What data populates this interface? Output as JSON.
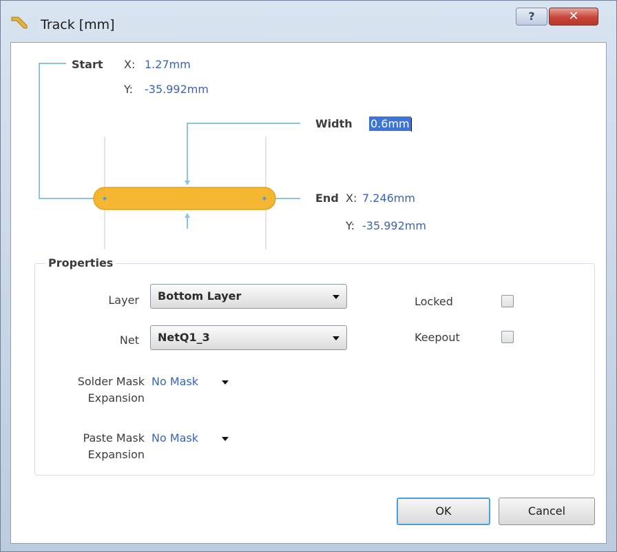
{
  "window": {
    "title": "Track [mm]",
    "help_label": "?",
    "close_label": "✕"
  },
  "diagram": {
    "start_label": "Start",
    "start_x_label": "X:",
    "start_x_value": "1.27mm",
    "start_y_label": "Y:",
    "start_y_value": "-35.992mm",
    "width_label": "Width",
    "width_value": "0.6mm",
    "end_label": "End",
    "end_x_label": "X:",
    "end_x_value": "7.246mm",
    "end_y_label": "Y:",
    "end_y_value": "-35.992mm"
  },
  "properties": {
    "group_title": "Properties",
    "layer_label": "Layer",
    "layer_value": "Bottom Layer",
    "net_label": "Net",
    "net_value": "NetQ1_3",
    "locked_label": "Locked",
    "keepout_label": "Keepout",
    "solder_mask_label_1": "Solder Mask",
    "solder_mask_label_2": "Expansion",
    "solder_mask_value": "No Mask",
    "paste_mask_label_1": "Paste Mask",
    "paste_mask_label_2": "Expansion",
    "paste_mask_value": "No Mask"
  },
  "buttons": {
    "ok_label": "OK",
    "cancel_label": "Cancel"
  },
  "colors": {
    "track": "#f5b731",
    "dimension_line": "#8ec3dd",
    "value_text": "#3b63b5",
    "selection": "#3d74d6"
  }
}
